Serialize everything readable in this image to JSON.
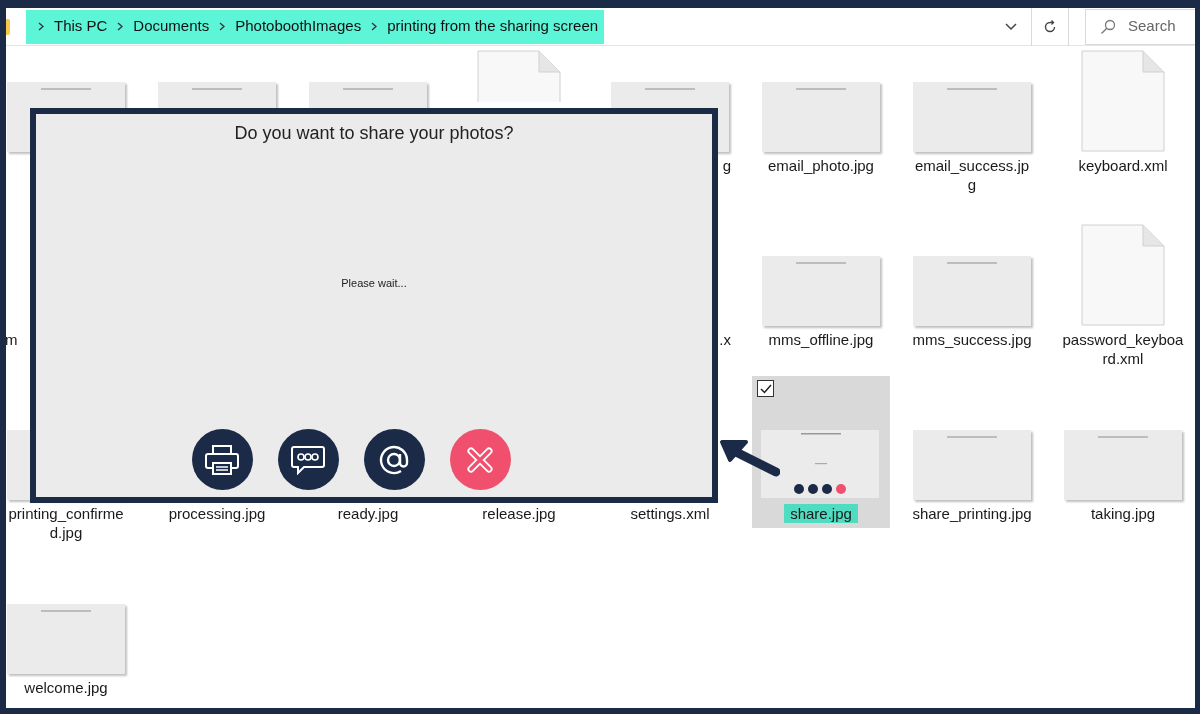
{
  "address_bar": {
    "highlighted": true,
    "breadcrumbs": [
      "This PC",
      "Documents",
      "PhotoboothImages",
      "printing from the sharing screen"
    ],
    "search": {
      "placeholder": "Search"
    }
  },
  "files": [
    {
      "kind": "image",
      "selected": false
    },
    {
      "kind": "image",
      "selected": false
    },
    {
      "kind": "image",
      "selected": false
    },
    {
      "kind": "document",
      "partly_hidden": true,
      "selected": false
    },
    {
      "kind": "image",
      "label": "g",
      "cut_at_start": true,
      "selected": false
    },
    {
      "kind": "image",
      "label": "email_photo.jpg",
      "selected": false
    },
    {
      "kind": "image",
      "label": "email_success.jpg",
      "selected": false
    },
    {
      "kind": "document",
      "label": "keyboard.xml",
      "selected": false
    },
    {
      "kind": "none",
      "label": "m",
      "cut_at_end": true,
      "selected": false
    },
    {
      "kind": "none"
    },
    {
      "kind": "none"
    },
    {
      "kind": "none"
    },
    {
      "kind": "none",
      "label": ".x",
      "cut_at_start": true,
      "selected": false
    },
    {
      "kind": "image",
      "label": "mms_offline.jpg",
      "selected": false
    },
    {
      "kind": "image",
      "label": "mms_success.jpg",
      "selected": false
    },
    {
      "kind": "document",
      "label": "password_keyboard.xml",
      "selected": false
    },
    {
      "kind": "image",
      "label": "printing_confirmed.jpg",
      "selected": false
    },
    {
      "kind": "none",
      "label": "processing.jpg",
      "selected": false
    },
    {
      "kind": "none",
      "label": "ready.jpg",
      "selected": false
    },
    {
      "kind": "none",
      "label": "release.jpg",
      "selected": false
    },
    {
      "kind": "none",
      "label": "settings.xml",
      "selected": false
    },
    {
      "kind": "share_preview",
      "label": "share.jpg",
      "selected": true,
      "checked": true,
      "highlighted": true
    },
    {
      "kind": "image",
      "label": "share_printing.jpg",
      "selected": false
    },
    {
      "kind": "image",
      "label": "taking.jpg",
      "selected": false
    },
    {
      "kind": "image",
      "label": "welcome.jpg",
      "selected": false
    }
  ],
  "dialog": {
    "title": "Do you want to share your photos?",
    "message": "Please wait...",
    "actions": [
      {
        "kind": "print"
      },
      {
        "kind": "message"
      },
      {
        "kind": "email"
      },
      {
        "kind": "cancel"
      }
    ]
  }
}
